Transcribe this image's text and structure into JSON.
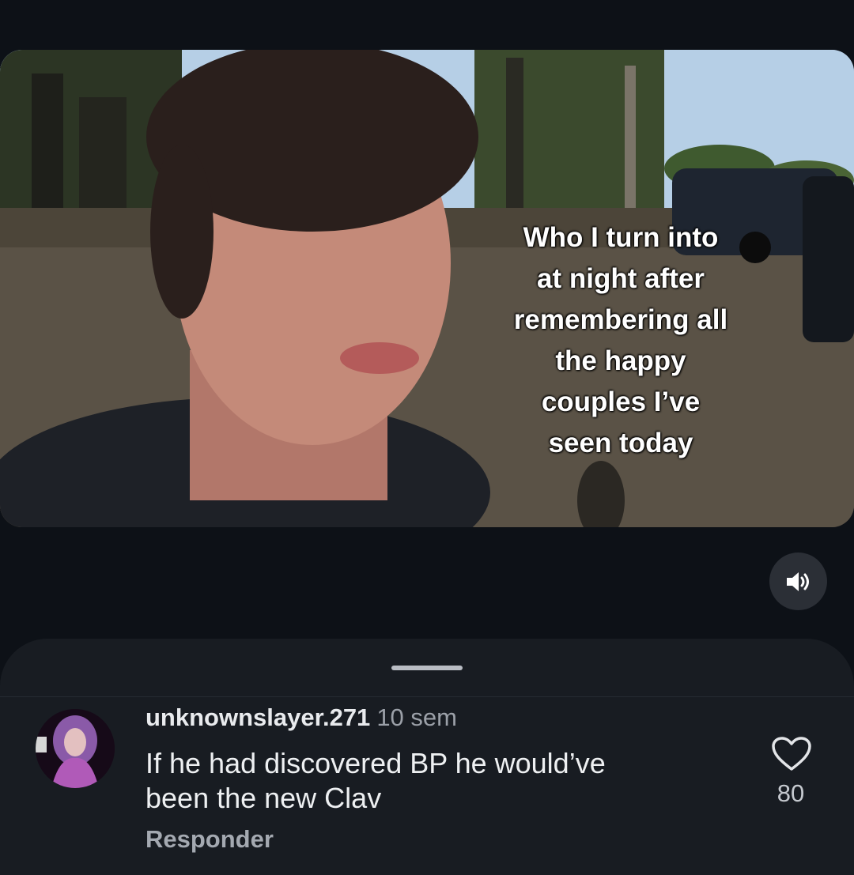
{
  "video": {
    "caption": "Who I turn into\nat night after\nremembering all\nthe happy\ncouples I’ve\nseen today"
  },
  "controls": {
    "sound_icon": "speaker-volume-icon"
  },
  "comment": {
    "username": "unknownslayer.271",
    "time": "10 sem",
    "text": "If he had discovered BP he would’ve\nbeen the new Clav",
    "reply_label": "Responder",
    "like_icon": "heart-outline-icon",
    "like_count": "80"
  }
}
